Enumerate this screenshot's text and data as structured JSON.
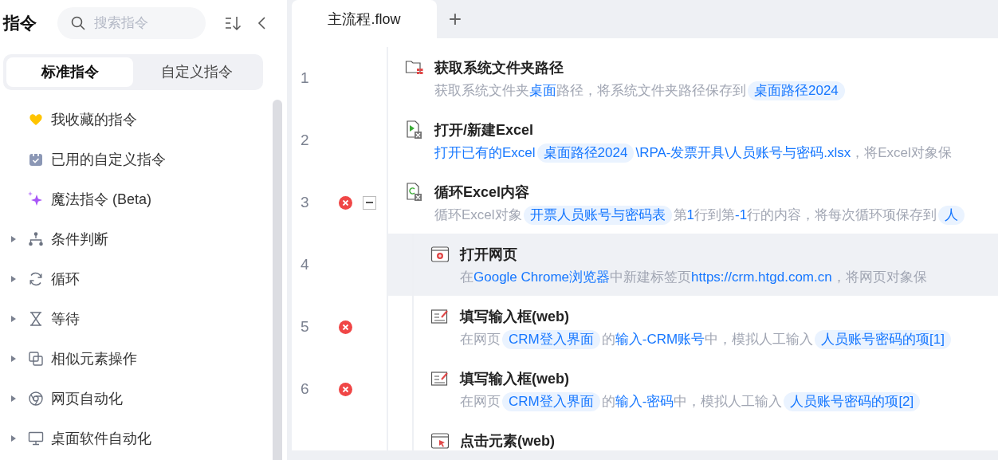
{
  "sidebar": {
    "title": "指令",
    "search": {
      "placeholder": "搜索指令"
    },
    "tabs": [
      {
        "label": "标准指令",
        "selected": true
      },
      {
        "label": "自定义指令",
        "selected": false
      }
    ],
    "items": [
      {
        "label": "我收藏的指令",
        "kind": "heart",
        "expandable": false
      },
      {
        "label": "已用的自定义指令",
        "kind": "calendar",
        "expandable": false
      },
      {
        "label": "魔法指令 (Beta)",
        "kind": "sparkle",
        "expandable": false
      },
      {
        "label": "条件判断",
        "kind": "branch",
        "expandable": true
      },
      {
        "label": "循环",
        "kind": "loop",
        "expandable": true
      },
      {
        "label": "等待",
        "kind": "hourglass",
        "expandable": true
      },
      {
        "label": "相似元素操作",
        "kind": "copy",
        "expandable": true
      },
      {
        "label": "网页自动化",
        "kind": "browser",
        "expandable": true
      },
      {
        "label": "桌面软件自动化",
        "kind": "monitor",
        "expandable": true
      }
    ]
  },
  "editor": {
    "tabs": [
      {
        "label": "主流程.flow",
        "selected": true
      }
    ],
    "add_tab": "+",
    "steps": [
      {
        "line": "1",
        "error": false,
        "selected": false,
        "kind": "folder",
        "title": "获取系统文件夹路径",
        "description": [
          {
            "kind": "text",
            "text": "获取系统文件夹"
          },
          {
            "kind": "value",
            "text": "桌面"
          },
          {
            "kind": "text",
            "text": "路径，将系统文件夹路径保存到"
          },
          {
            "kind": "variable",
            "text": "桌面路径2024"
          }
        ]
      },
      {
        "line": "2",
        "error": false,
        "selected": false,
        "kind": "excel-open",
        "title": "打开/新建Excel",
        "description": [
          {
            "kind": "value",
            "text": "打开已有的Excel"
          },
          {
            "kind": "variable",
            "text": "桌面路径2024"
          },
          {
            "kind": "value",
            "text": "\\RPA-发票开具\\人员账号与密码.xlsx"
          },
          {
            "kind": "text",
            "text": "，将Excel对象保"
          }
        ]
      },
      {
        "line": "3",
        "error": true,
        "selected": false,
        "expanded": true,
        "kind": "excel-loop",
        "title": "循环Excel内容",
        "description": [
          {
            "kind": "text",
            "text": "循环Excel对象"
          },
          {
            "kind": "variable",
            "text": "开票人员账号与密码表"
          },
          {
            "kind": "text",
            "text": "第"
          },
          {
            "kind": "value",
            "text": "1"
          },
          {
            "kind": "text",
            "text": "行到第"
          },
          {
            "kind": "value",
            "text": "-1"
          },
          {
            "kind": "text",
            "text": "行的内容，将每次循环项保存到"
          },
          {
            "kind": "variable",
            "text": "人"
          }
        ],
        "children": [
          {
            "line": "4",
            "error": false,
            "selected": true,
            "kind": "web-open",
            "title": "打开网页",
            "description": [
              {
                "kind": "text",
                "text": "在"
              },
              {
                "kind": "value",
                "text": "Google Chrome浏览器"
              },
              {
                "kind": "text",
                "text": "中新建标签页"
              },
              {
                "kind": "value",
                "text": "https://crm.htgd.com.cn"
              },
              {
                "kind": "text",
                "text": "，将网页对象保"
              }
            ]
          },
          {
            "line": "5",
            "error": true,
            "selected": false,
            "kind": "input",
            "title": "填写输入框(web)",
            "description": [
              {
                "kind": "text",
                "text": "在网页"
              },
              {
                "kind": "variable",
                "text": "CRM登入界面"
              },
              {
                "kind": "text",
                "text": "的"
              },
              {
                "kind": "value",
                "text": "输入-CRM账号"
              },
              {
                "kind": "text",
                "text": "中，模拟人工输入"
              },
              {
                "kind": "variable",
                "text": "人员账号密码的项[1]"
              }
            ]
          },
          {
            "line": "6",
            "error": true,
            "selected": false,
            "kind": "input",
            "title": "填写输入框(web)",
            "description": [
              {
                "kind": "text",
                "text": "在网页"
              },
              {
                "kind": "variable",
                "text": "CRM登入界面"
              },
              {
                "kind": "text",
                "text": "的"
              },
              {
                "kind": "value",
                "text": "输入-密码"
              },
              {
                "kind": "text",
                "text": "中，模拟人工输入"
              },
              {
                "kind": "variable",
                "text": "人员账号密码的项[2]"
              }
            ]
          },
          {
            "selected": false,
            "kind": "click",
            "title": "点击元素(web)"
          }
        ]
      }
    ]
  }
}
